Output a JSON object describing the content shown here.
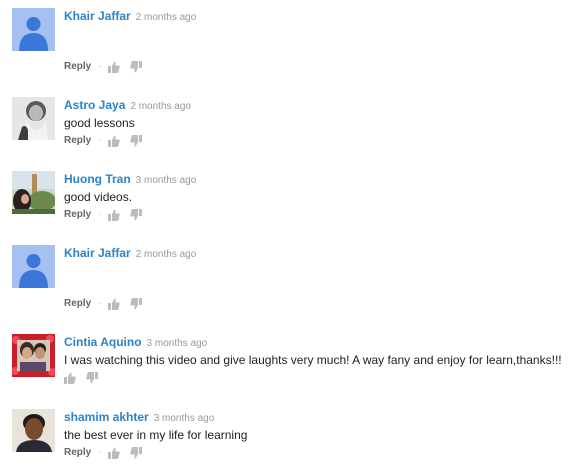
{
  "comments": [
    {
      "author": "Khair Jaffar",
      "time": "2 months ago",
      "text": "",
      "reply": "Reply",
      "avatar": "default-user-avatar"
    },
    {
      "author": "Astro Jaya",
      "time": "2 months ago",
      "text": "good lessons",
      "reply": "Reply",
      "avatar": "bearded-man-photo"
    },
    {
      "author": "Huong Tran",
      "time": "3 months ago",
      "text": "good videos.",
      "reply": "Reply",
      "avatar": "outdoor-photo"
    },
    {
      "author": "Khair Jaffar",
      "time": "2 months ago",
      "text": "",
      "reply": "Reply",
      "avatar": "default-user-avatar"
    },
    {
      "author": "Cintia Aquino",
      "time": "3 months ago",
      "text": "I was watching this video and give laughts very much! A way fany and enjoy for learn,thanks!!!",
      "reply": "",
      "avatar": "couple-photo"
    },
    {
      "author": "shamim akhter",
      "time": "3 months ago",
      "text": "the best ever in my life for learning",
      "reply": "Reply",
      "avatar": "man-portrait-photo"
    }
  ],
  "dot_separator": "·",
  "colors": {
    "author": "#2c83c8",
    "time": "#999999",
    "icon": "#bcbcbc",
    "default_avatar_bg": "#a4c1f2",
    "default_avatar_fg": "#3a77d8"
  }
}
